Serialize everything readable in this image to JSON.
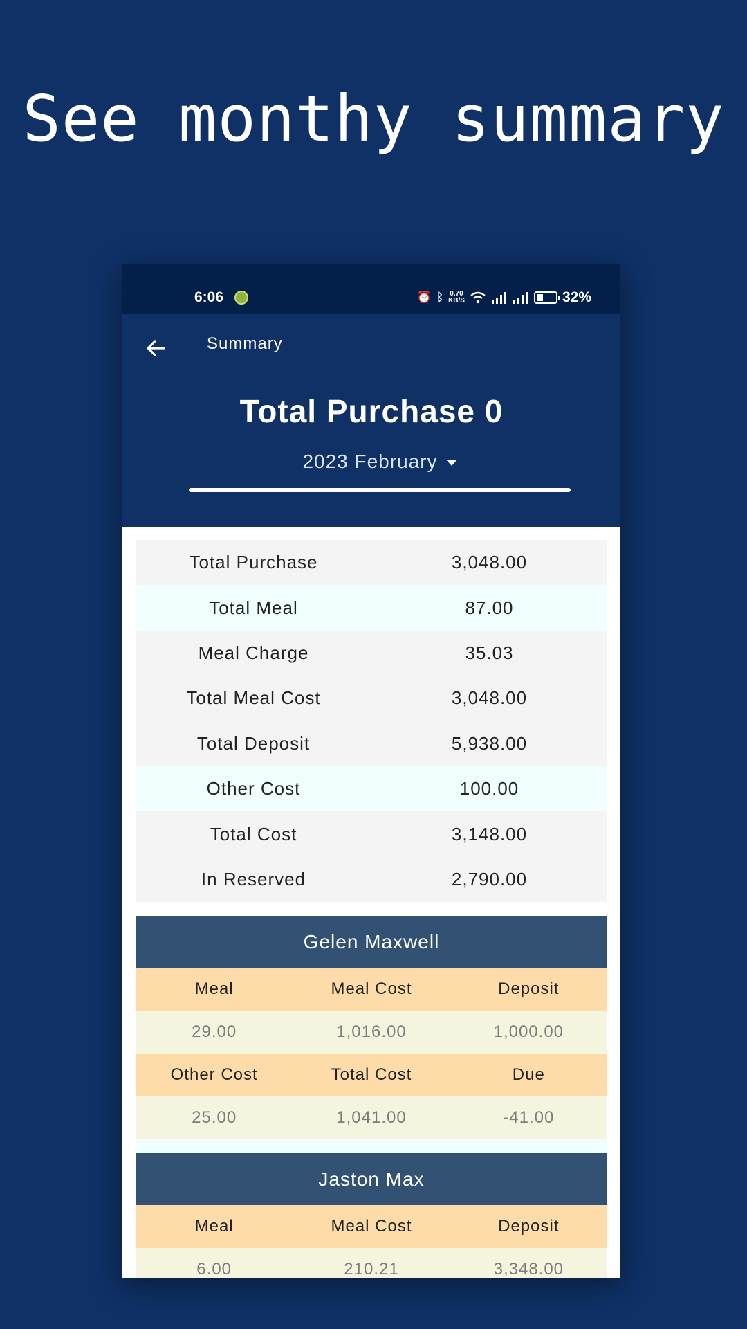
{
  "promo": {
    "title": "See monthy summary"
  },
  "status_bar": {
    "time": "6:06",
    "speed_top": "0.70",
    "speed_bottom": "KB/S",
    "battery": "32%"
  },
  "app_bar": {
    "title": "Summary"
  },
  "header": {
    "total_purchase": "Total Purchase 0",
    "month": "2023 February"
  },
  "summary": {
    "rows": [
      {
        "label": "Total Purchase",
        "value": "3,048.00"
      },
      {
        "label": "Total Meal",
        "value": "87.00"
      },
      {
        "label": "Meal Charge",
        "value": "35.03"
      },
      {
        "label": "Total Meal Cost",
        "value": "3,048.00"
      },
      {
        "label": "Total Deposit",
        "value": "5,938.00"
      },
      {
        "label": "Other Cost",
        "value": "100.00"
      },
      {
        "label": "Total Cost",
        "value": "3,148.00"
      },
      {
        "label": "In Reserved",
        "value": "2,790.00"
      }
    ]
  },
  "members": [
    {
      "name": "Gelen Maxwell",
      "head1": [
        "Meal",
        "Meal Cost",
        "Deposit"
      ],
      "val1": [
        "29.00",
        "1,016.00",
        "1,000.00"
      ],
      "head2": [
        "Other Cost",
        "Total Cost",
        "Due"
      ],
      "val2": [
        "25.00",
        "1,041.00",
        "-41.00"
      ]
    },
    {
      "name": "Jaston Max",
      "head1": [
        "Meal",
        "Meal Cost",
        "Deposit"
      ],
      "val1": [
        "6.00",
        "210.21",
        "3,348.00"
      ]
    }
  ]
}
